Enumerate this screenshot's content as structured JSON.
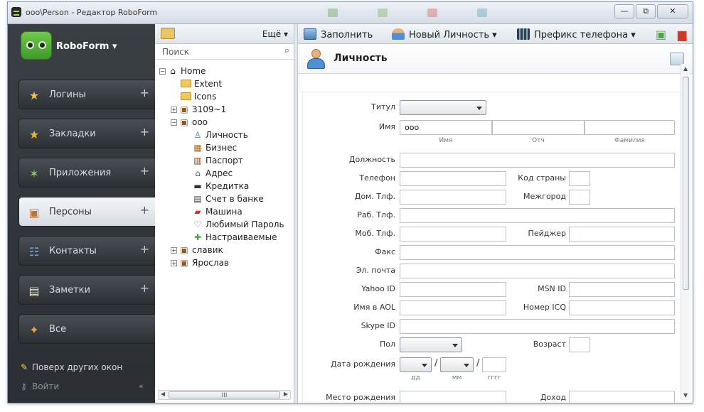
{
  "window": {
    "title": "ooo\\Person - Редактор RoboForm",
    "controls": {
      "minimize": "—",
      "maximize": "⧉",
      "close": "✕"
    }
  },
  "sidebar": {
    "logo": "RoboForm ▾",
    "items": [
      {
        "label": "Логины",
        "icon": "star-icon",
        "plus": "+"
      },
      {
        "label": "Закладки",
        "icon": "bookmark-star-icon",
        "plus": "+"
      },
      {
        "label": "Приложения",
        "icon": "apps-star-icon",
        "plus": "+"
      },
      {
        "label": "Персоны",
        "icon": "id-card-icon",
        "plus": "+"
      },
      {
        "label": "Контакты",
        "icon": "contacts-icon",
        "plus": "+"
      },
      {
        "label": "Заметки",
        "icon": "notes-icon",
        "plus": "+"
      },
      {
        "label": "Все",
        "icon": "all-icon"
      }
    ],
    "footer": {
      "on_top": "Поверх других окон",
      "login": "Войти",
      "collapse": "«"
    }
  },
  "tree": {
    "more": "Ещё ▾",
    "search_placeholder": "Поиск",
    "nodes": [
      {
        "label": "Home",
        "expander": "−"
      },
      {
        "label": "Extent"
      },
      {
        "label": "Icons"
      },
      {
        "label": "3109~1",
        "expander": "+"
      },
      {
        "label": "ooo",
        "expander": "−"
      },
      {
        "label": "Личность"
      },
      {
        "label": "Бизнес"
      },
      {
        "label": "Паспорт"
      },
      {
        "label": "Адрес"
      },
      {
        "label": "Кредитка"
      },
      {
        "label": "Счет в банке"
      },
      {
        "label": "Машина"
      },
      {
        "label": "Любимый Пароль"
      },
      {
        "label": "Настраиваемые"
      },
      {
        "label": "славик",
        "expander": "+"
      },
      {
        "label": "Ярослав",
        "expander": "+"
      }
    ],
    "scroll_thumb": "III"
  },
  "toolbar": {
    "fill": "Заполнить",
    "new_identity": "Новый Личность ▾",
    "phone_prefix": "Префикс телефона ▾"
  },
  "editor": {
    "title": "Личность",
    "fields": {
      "title_label": "Титул",
      "name_label": "Имя",
      "name_first": "ooo",
      "hint_first": "Имя",
      "hint_middle": "Отч",
      "hint_last": "Фамилия",
      "position_label": "Должность",
      "phone_label": "Телефон",
      "country_code_label": "Код страны",
      "home_phone_label": "Дом. Тлф.",
      "area_code_label": "Межгород",
      "work_phone_label": "Раб. Тлф.",
      "mobile_label": "Моб. Тлф.",
      "pager_label": "Пейджер",
      "fax_label": "Факс",
      "email_label": "Эл. почта",
      "yahoo_label": "Yahoo ID",
      "msn_label": "MSN ID",
      "aol_label": "Имя в AOL",
      "icq_label": "Номер ICQ",
      "skype_label": "Skype ID",
      "sex_label": "Пол",
      "age_label": "Возраст",
      "birthdate_label": "Дата рождения",
      "date_sep": "/",
      "hint_dd": "дд",
      "hint_mm": "мм",
      "hint_yyyy": "гггг",
      "birthplace_label": "Место рождения",
      "income_label": "Доход"
    }
  }
}
